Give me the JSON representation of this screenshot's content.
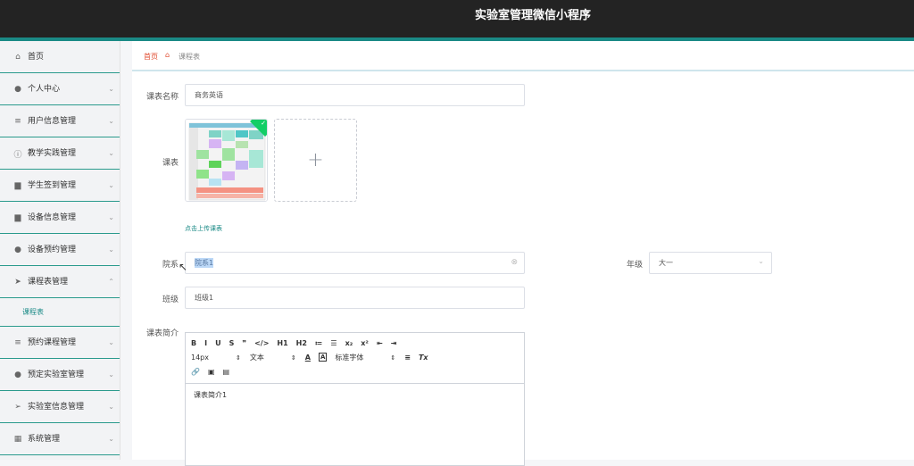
{
  "app": {
    "title": "实验室管理微信小程序"
  },
  "sidebar": {
    "items": [
      {
        "label": "首页",
        "icon": "home-icon",
        "glyph": "⌂",
        "has_arrow": false
      },
      {
        "label": "个人中心",
        "icon": "user-icon",
        "glyph": "●",
        "has_arrow": true
      },
      {
        "label": "用户信息管理",
        "icon": "list-icon",
        "glyph": "≡",
        "has_arrow": true
      },
      {
        "label": "教学实践管理",
        "icon": "info-circle-icon",
        "glyph": "ⓘ",
        "has_arrow": true
      },
      {
        "label": "学生签到管理",
        "icon": "printer-icon",
        "glyph": "▆",
        "has_arrow": true
      },
      {
        "label": "设备信息管理",
        "icon": "chat-icon",
        "glyph": "▆",
        "has_arrow": true
      },
      {
        "label": "设备预约管理",
        "icon": "user-icon",
        "glyph": "●",
        "has_arrow": true
      },
      {
        "label": "课程表管理",
        "icon": "send-icon",
        "glyph": "➤",
        "has_arrow": true,
        "expanded": true
      }
    ],
    "sub_items": [
      {
        "label": "课程表"
      }
    ],
    "items_after": [
      {
        "label": "预约课程管理",
        "icon": "list-icon",
        "glyph": "≡",
        "has_arrow": true
      },
      {
        "label": "预定实验室管理",
        "icon": "user-icon",
        "glyph": "●",
        "has_arrow": true
      },
      {
        "label": "实验室信息管理",
        "icon": "location-icon",
        "glyph": "➢",
        "has_arrow": true
      },
      {
        "label": "系统管理",
        "icon": "grid-icon",
        "glyph": "▦",
        "has_arrow": true
      }
    ]
  },
  "breadcrumb": {
    "home": "首页",
    "current": "课程表"
  },
  "form": {
    "name_label": "课表名称",
    "name_value": "商务英语",
    "schedule_label": "课表",
    "upload_hint": "点击上传课表",
    "dept_label": "院系",
    "dept_value": "院系1",
    "grade_label": "年级",
    "grade_value": "大一",
    "class_label": "班级",
    "class_value": "班级1",
    "intro_label": "课表简介",
    "intro_value": "课表简介1"
  },
  "editor": {
    "row1": [
      "B",
      "I",
      "U",
      "S",
      "❞",
      "</>",
      "H1",
      "H2",
      "≔",
      "☰",
      "x₂",
      "x²",
      "⇤",
      "⇥"
    ],
    "font_size": "14px",
    "text_type": "文本",
    "font_family": "标准字体",
    "color_label": "A",
    "bg_label": "A",
    "align": "≡",
    "clear": "Tx"
  },
  "colors": {
    "accent": "#1a8a86",
    "header": "#232323",
    "breadcrumb_home": "#e0492d"
  }
}
